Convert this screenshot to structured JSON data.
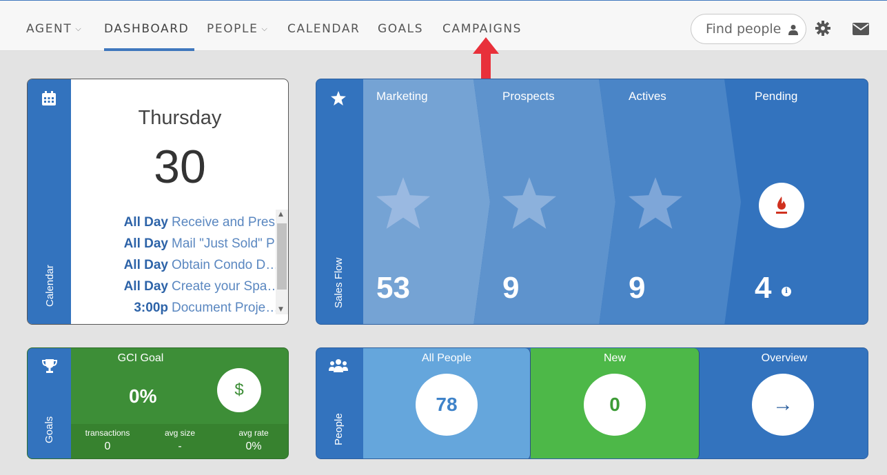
{
  "nav": {
    "agent": "AGENT",
    "dashboard": "DASHBOARD",
    "people": "PEOPLE",
    "calendar": "CALENDAR",
    "goals": "GOALS",
    "campaigns": "CAMPAIGNS",
    "search_placeholder": "Find people"
  },
  "calendar": {
    "side_label": "Calendar",
    "day": "Thursday",
    "date": "30",
    "events": [
      {
        "time": "All Day",
        "text": "Receive and Pres…"
      },
      {
        "time": "All Day",
        "text": "Mail \"Just Sold\" P…"
      },
      {
        "time": "All Day",
        "text": "Obtain Condo D…"
      },
      {
        "time": "All Day",
        "text": "Create your Spa…"
      },
      {
        "time": "3:00p",
        "text": "Document Proje…"
      }
    ]
  },
  "sales_flow": {
    "side_label": "Sales Flow",
    "stages": [
      {
        "title": "Marketing",
        "count": "53"
      },
      {
        "title": "Prospects",
        "count": "9"
      },
      {
        "title": "Actives",
        "count": "9"
      },
      {
        "title": "Pending",
        "count": "4"
      }
    ]
  },
  "goals": {
    "side_label": "Goals",
    "title": "GCI Goal",
    "percent": "0%",
    "dollar": "$",
    "stats": [
      {
        "label": "transactions",
        "value": "0"
      },
      {
        "label": "avg size",
        "value": "-"
      },
      {
        "label": "avg rate",
        "value": "0%"
      }
    ]
  },
  "people": {
    "side_label": "People",
    "segments": [
      {
        "title": "All People",
        "value": "78"
      },
      {
        "title": "New",
        "value": "0"
      },
      {
        "title": "Overview",
        "value": "→"
      }
    ]
  },
  "colors": {
    "brand_blue": "#3373be",
    "goals_green": "#3d8e37",
    "new_green": "#4db848",
    "all_people_blue": "#65a6dc",
    "arrow_red": "#e8303a"
  }
}
